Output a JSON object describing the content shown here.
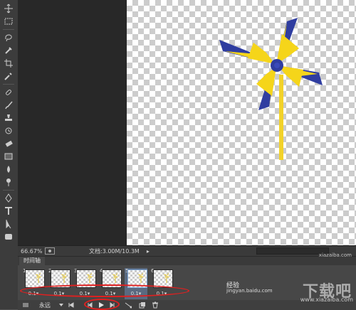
{
  "status_bar": {
    "zoom": "66.67%",
    "doc_info": "文档:3.00M/10.3M",
    "arrow": "▸"
  },
  "timeline": {
    "tab_label": "时间轴",
    "frames": [
      {
        "num": "1",
        "delay": "0.1▾"
      },
      {
        "num": "2",
        "delay": "0.1▾"
      },
      {
        "num": "3",
        "delay": "0.1▾"
      },
      {
        "num": "4",
        "delay": "0.1▾"
      },
      {
        "num": "5",
        "delay": "0.1▾"
      },
      {
        "num": "6",
        "delay": "0.1▾"
      }
    ],
    "loop_label": "永远",
    "selected_frame": "5"
  },
  "watermarks": {
    "brand": "下载吧",
    "brand_url": "www.xiazaiba.com",
    "jy_label": "经验",
    "jy_url": "jingyan.baidu.com",
    "corner": "xiazaiba.com"
  },
  "tool_icons": [
    "move-icon",
    "marquee-icon",
    "lasso-icon",
    "quick-select-icon",
    "crop-icon",
    "eyedropper-icon",
    "healing-brush-icon",
    "brush-icon",
    "clone-stamp-icon",
    "history-brush-icon",
    "eraser-icon",
    "gradient-icon",
    "blur-icon",
    "dodge-icon",
    "pen-icon",
    "type-icon",
    "path-select-icon",
    "shape-icon",
    "hand-icon",
    "zoom-icon"
  ],
  "colors": {
    "pinwheel_yellow": "#f5d51a",
    "pinwheel_blue": "#2f3da0",
    "annotation_red": "#e02020"
  }
}
